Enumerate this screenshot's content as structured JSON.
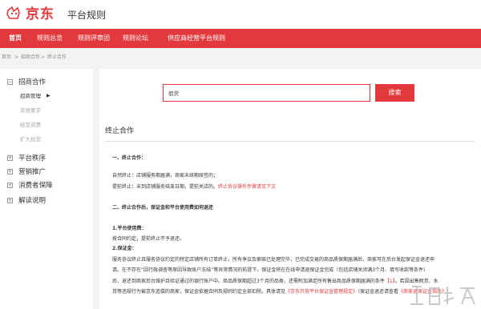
{
  "brand": {
    "logo_text": "京东",
    "site_title": "平台规则",
    "brand_color": "#e4393c"
  },
  "nav": [
    {
      "label": "首页"
    },
    {
      "label": "规则总览"
    },
    {
      "label": "规则评审团"
    },
    {
      "label": "规则论坛"
    },
    {
      "label": "供应商经营平台规则"
    }
  ],
  "breadcrumb": [
    "首页",
    ">",
    "招商合作",
    ">",
    "终止合作"
  ],
  "sidebar": {
    "groups": [
      {
        "icon": "minus-square-icon",
        "label": "招商合作",
        "children": [
          {
            "label": "招商管理",
            "current": true
          },
          {
            "label": "资质要求"
          },
          {
            "label": "经营资费"
          },
          {
            "label": "扩大经营"
          }
        ]
      },
      {
        "icon": "plus-square-icon",
        "label": "平台秩序"
      },
      {
        "icon": "plus-square-icon",
        "label": "营销推广"
      },
      {
        "icon": "plus-square-icon",
        "label": "消费者保障"
      },
      {
        "icon": "plus-square-icon",
        "label": "解读说明"
      }
    ]
  },
  "search": {
    "value": "假货",
    "button_label": "搜索"
  },
  "article": {
    "title": "终止合作",
    "lines": [
      {
        "text": "一、终止合作：",
        "bold": true
      },
      {
        "text": "自然终止：店铺服务期届满，商家未续期续签的；"
      },
      {
        "segments": [
          {
            "text": "提前终止：未到店铺服务结束日期，提前关店的。"
          },
          {
            "text": "终止协议操作步骤请见下文",
            "link": true
          }
        ]
      },
      {
        "text": "二、终止合作后，保证金和平台使用费如何退还",
        "bold": true
      },
      {
        "text": "1.平台使用费：",
        "bold": true
      },
      {
        "text": "按合同约定，提前终止不予退还。"
      },
      {
        "text": "2.保证金：",
        "bold": true
      },
      {
        "text": "服务协议终止且服务协议约定的特定店铺所有订单终止，所有争议及索赔已处理完毕，已完成交易的商品质保期届满后，商家可在后台发起保证金退还申"
      },
      {
        "text": "请。在不存在“因行政调查等原因导致账户冻结”等异常情况的前提下，保证金将在在线申请退保证金完成（包括店铺关闭满3个月、填写收款等条件）"
      },
      {
        "segments": [
          {
            "text": "后，退还到商家后台维护且验证通过的银行账户中。商品质保期超过3个月的品类，还需附加满足所有售出商品质保期届满的条件"
          },
          {
            "text": "【1】",
            "link": true
          },
          {
            "text": "。若因出售假货、水"
          }
        ]
      },
      {
        "segments": [
          {
            "text": "货等违规行为被京东追偿的商家，保证金依据合同及规则约定全部扣除。具体请见"
          },
          {
            "text": "《京东开放平台保证金管理规定》",
            "link": true
          },
          {
            "text": "（保证金退还请查看"
          },
          {
            "text": "《商家退保证金指南》",
            "link": true
          }
        ]
      }
    ]
  }
}
